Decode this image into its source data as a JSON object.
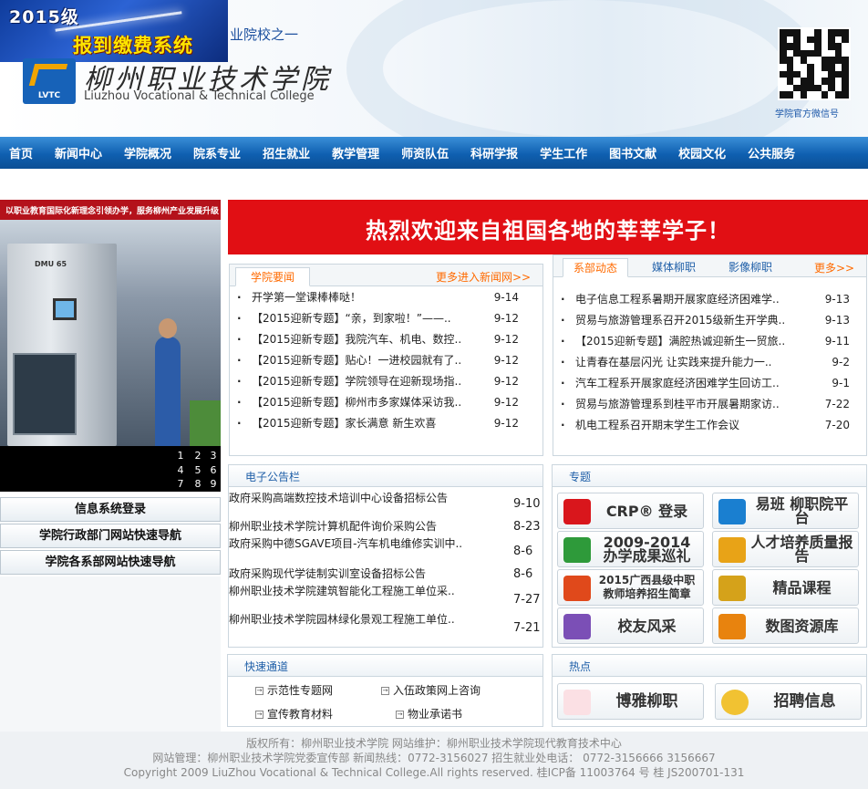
{
  "header": {
    "promo_line1": "2015级",
    "promo_line2": "报到缴费系统",
    "tagline": "业院校之一",
    "logo_abbr": "LVTC",
    "college_cn": "柳州职业技术学院",
    "college_en": "Liuzhou Vocational & Technical College",
    "qr_caption": "学院官方微信号"
  },
  "nav": [
    "首页",
    "新闻中心",
    "学院概况",
    "院系专业",
    "招生就业",
    "教学管理",
    "师资队伍",
    "科研学报",
    "学生工作",
    "图书文献",
    "校园文化",
    "公共服务"
  ],
  "feature": {
    "title": "以职业教育国际化新理念引领办学，服务柳州产业发展升级",
    "machine_label": "DMU 65",
    "pager": [
      "1",
      "2",
      "3",
      "4",
      "5",
      "6",
      "7",
      "8",
      "9"
    ]
  },
  "left_buttons": [
    "信息系统登录",
    "学院行政部门网站快速导航",
    "学院各系部网站快速导航"
  ],
  "banner": "热烈欢迎来自祖国各地的莘莘学子！",
  "news": {
    "tab": "学院要闻",
    "more": "更多进入新闻网>>",
    "items": [
      {
        "title": "开学第一堂课棒棒哒！",
        "date": "9-14"
      },
      {
        "title": "【2015迎新专题】“亲，到家啦！”——..",
        "date": "9-12"
      },
      {
        "title": "【2015迎新专题】我院汽车、机电、数控..",
        "date": "9-12"
      },
      {
        "title": "【2015迎新专题】贴心！一进校园就有了..",
        "date": "9-12"
      },
      {
        "title": "【2015迎新专题】学院领导在迎新现场指..",
        "date": "9-12"
      },
      {
        "title": "【2015迎新专题】柳州市多家媒体采访我..",
        "date": "9-12"
      },
      {
        "title": "【2015迎新专题】家长满意 新生欢喜",
        "date": "9-12"
      }
    ]
  },
  "dept": {
    "tabs": [
      "系部动态",
      "媒体柳职",
      "影像柳职"
    ],
    "more": "更多>>",
    "items": [
      {
        "title": "电子信息工程系暑期开展家庭经济困难学..",
        "date": "9-13"
      },
      {
        "title": "贸易与旅游管理系召开2015级新生开学典..",
        "date": "9-13"
      },
      {
        "title": "【2015迎新专题】满腔热诚迎新生一贸旅..",
        "date": "9-11"
      },
      {
        "title": "让青春在基层闪光 让实践来提升能力一..",
        "date": "9-2"
      },
      {
        "title": "汽车工程系开展家庭经济困难学生回访工..",
        "date": "9-1"
      },
      {
        "title": "贸易与旅游管理系到桂平市开展暑期家访..",
        "date": "7-22"
      },
      {
        "title": "机电工程系召开期末学生工作会议",
        "date": "7-20"
      }
    ]
  },
  "notices": {
    "heading": "电子公告栏",
    "items": [
      {
        "title": "政府采购高端数控技术培训中心设备招标公告",
        "date": "9-10"
      },
      {
        "title": "柳州职业技术学院计算机配件询价采购公告",
        "date": "8-23"
      },
      {
        "title": "政府采购中德SGAVE项目-汽车机电维修实训中..",
        "date": "8-6"
      },
      {
        "title": "政府采购现代学徒制实训室设备招标公告",
        "date": "8-6"
      },
      {
        "title": "柳州职业技术学院建筑智能化工程施工单位采..",
        "date": "7-27"
      },
      {
        "title": "柳州职业技术学院园林绿化景观工程施工单位..",
        "date": "7-21"
      }
    ]
  },
  "special": {
    "heading": "专题",
    "tiles": [
      {
        "label": "CRP® 登录",
        "color": "#d9161c"
      },
      {
        "label": "易班 柳职院平台",
        "color": "#1a7fd0"
      },
      {
        "label": "2009-2014 办学成果巡礼",
        "color": "#2e9a3a"
      },
      {
        "label": "人才培养质量报告",
        "color": "#e8a317"
      },
      {
        "label": "2015广西县级中职教师培养招生简章",
        "color": "#e0491b"
      },
      {
        "label": "精品课程",
        "color": "#d5a21a"
      },
      {
        "label": "校友风采",
        "color": "#7b4fb6"
      },
      {
        "label": "数图资源库",
        "color": "#e8830e"
      }
    ]
  },
  "quick": {
    "heading": "快速通道",
    "links": [
      "示范性专题网",
      "入伍政策网上咨询",
      "宣传教育材料",
      "物业承诺书"
    ]
  },
  "hot": {
    "heading": "热点",
    "tiles": [
      "博雅柳职",
      "招聘信息"
    ]
  },
  "footer": {
    "line1": "版权所有：柳州职业技术学院  网站维护：柳州职业技术学院现代教育技术中心",
    "line2": "网站管理：柳州职业技术学院党委宣传部 新闻热线：0772-3156027 招生就业处电话：  0772-3156666 3156667",
    "line3": "Copyright 2009 LiuZhou Vocational & Technical College.All rights reserved. 桂ICP备 11003764 号 桂 JS200701-131"
  }
}
